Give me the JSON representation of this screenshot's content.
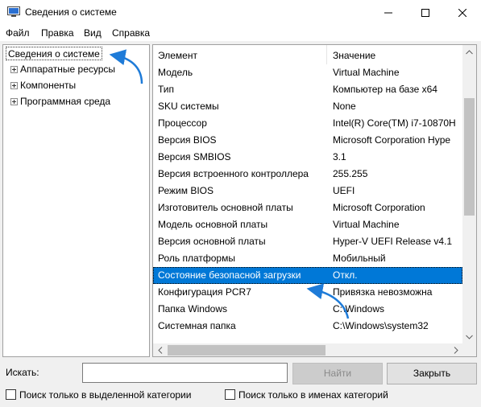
{
  "window": {
    "title": "Сведения о системе",
    "icon": "system-info-icon"
  },
  "menu": [
    "Файл",
    "Правка",
    "Вид",
    "Справка"
  ],
  "tree": {
    "root": "Сведения о системе",
    "children": [
      "Аппаратные ресурсы",
      "Компоненты",
      "Программная среда"
    ]
  },
  "table": {
    "headers": [
      "Элемент",
      "Значение"
    ],
    "rows": [
      [
        "Модель",
        "Virtual Machine"
      ],
      [
        "Тип",
        "Компьютер на базе x64"
      ],
      [
        "SKU системы",
        "None"
      ],
      [
        "Процессор",
        "Intel(R) Core(TM) i7-10870H"
      ],
      [
        "Версия BIOS",
        "Microsoft Corporation Hype"
      ],
      [
        "Версия SMBIOS",
        "3.1"
      ],
      [
        "Версия встроенного контроллера",
        "255.255"
      ],
      [
        "Режим BIOS",
        "UEFI"
      ],
      [
        "Изготовитель основной платы",
        "Microsoft Corporation"
      ],
      [
        "Модель основной платы",
        "Virtual Machine"
      ],
      [
        "Версия основной платы",
        "Hyper-V UEFI Release v4.1"
      ],
      [
        "Роль платформы",
        "Мобильный"
      ],
      [
        "Состояние безопасной загрузки",
        "Откл."
      ],
      [
        "Конфигурация PCR7",
        "Привязка невозможна"
      ],
      [
        "Папка Windows",
        "C:\\Windows"
      ],
      [
        "Системная папка",
        "C:\\Windows\\system32"
      ]
    ],
    "selected_row": 12
  },
  "search": {
    "label": "Искать:",
    "value": "",
    "find_button": "Найти",
    "close_button": "Закрыть"
  },
  "checkboxes": [
    "Поиск только в выделенной категории",
    "Поиск только в именах категорий"
  ],
  "colors": {
    "selection": "#0078d7",
    "annotation_arrow": "#1e7bd8"
  }
}
